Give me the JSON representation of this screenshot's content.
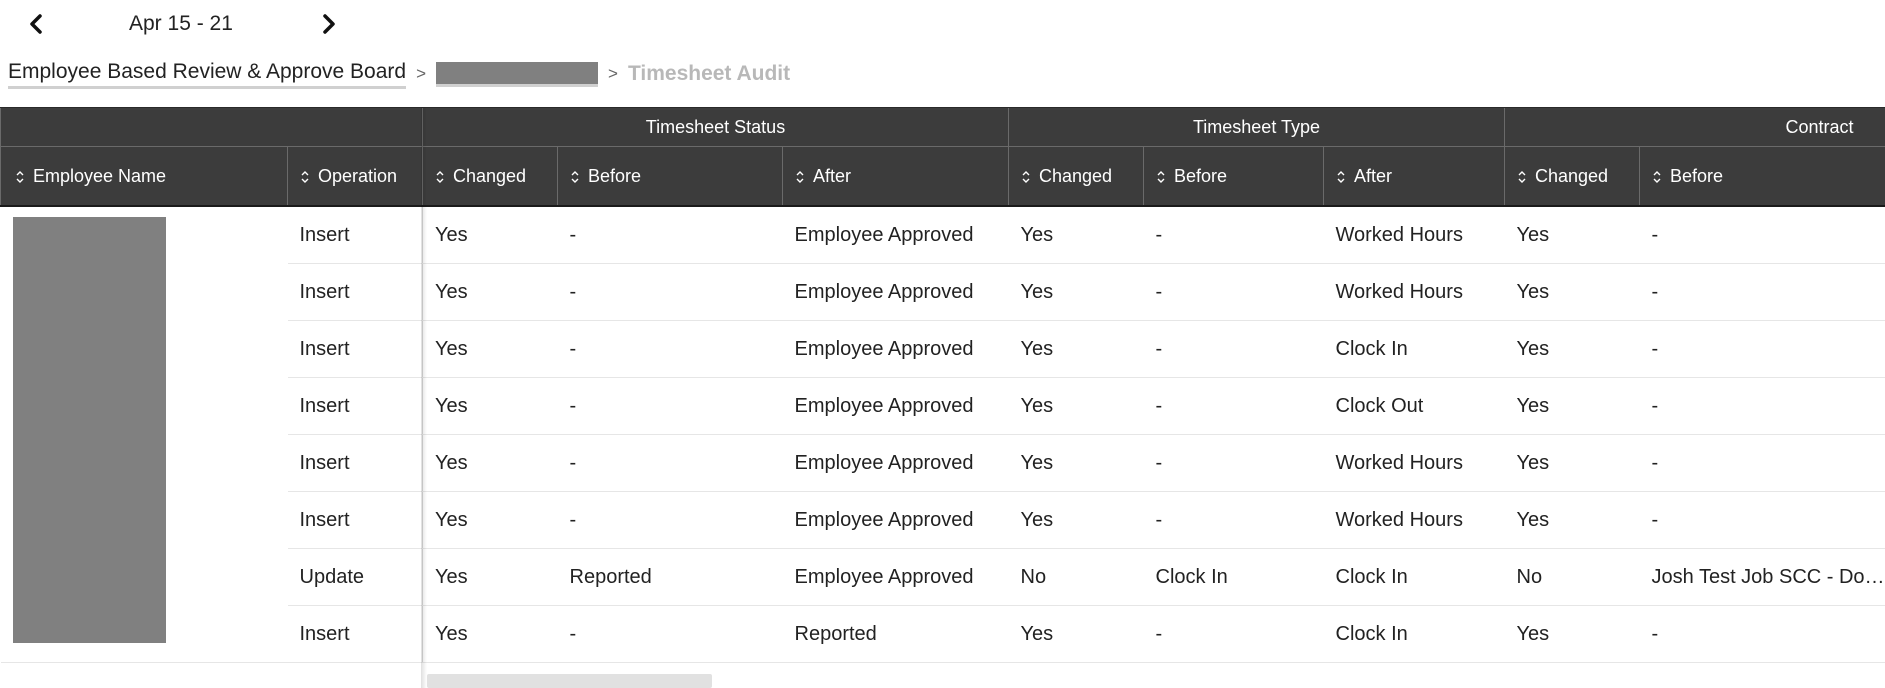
{
  "header": {
    "date_range": "Apr 15 - 21",
    "prev_icon": "chevron-left-icon",
    "next_icon": "chevron-right-icon"
  },
  "breadcrumb": {
    "board": "Employee Based Review & Approve Board",
    "sep1": ">",
    "sep2": ">",
    "current": "Timesheet Audit"
  },
  "table": {
    "groups": {
      "timesheet_status": "Timesheet Status",
      "timesheet_type": "Timesheet Type",
      "contract": "Contract"
    },
    "columns": {
      "employee_name": "Employee Name",
      "operation": "Operation",
      "ts_changed": "Changed",
      "ts_before": "Before",
      "ts_after": "After",
      "tt_changed": "Changed",
      "tt_before": "Before",
      "tt_after": "After",
      "c_changed": "Changed",
      "c_before": "Before"
    },
    "sort_icon": "sort-icon",
    "rows": [
      {
        "operation": "Insert",
        "ts_changed": "Yes",
        "ts_before": "-",
        "ts_after": "Employee Approved",
        "tt_changed": "Yes",
        "tt_before": "-",
        "tt_after": "Worked Hours",
        "c_changed": "Yes",
        "c_before": "-"
      },
      {
        "operation": "Insert",
        "ts_changed": "Yes",
        "ts_before": "-",
        "ts_after": "Employee Approved",
        "tt_changed": "Yes",
        "tt_before": "-",
        "tt_after": "Worked Hours",
        "c_changed": "Yes",
        "c_before": "-"
      },
      {
        "operation": "Insert",
        "ts_changed": "Yes",
        "ts_before": "-",
        "ts_after": "Employee Approved",
        "tt_changed": "Yes",
        "tt_before": "-",
        "tt_after": "Clock In",
        "c_changed": "Yes",
        "c_before": "-"
      },
      {
        "operation": "Insert",
        "ts_changed": "Yes",
        "ts_before": "-",
        "ts_after": "Employee Approved",
        "tt_changed": "Yes",
        "tt_before": "-",
        "tt_after": "Clock Out",
        "c_changed": "Yes",
        "c_before": "-"
      },
      {
        "operation": "Insert",
        "ts_changed": "Yes",
        "ts_before": "-",
        "ts_after": "Employee Approved",
        "tt_changed": "Yes",
        "tt_before": "-",
        "tt_after": "Worked Hours",
        "c_changed": "Yes",
        "c_before": "-"
      },
      {
        "operation": "Insert",
        "ts_changed": "Yes",
        "ts_before": "-",
        "ts_after": "Employee Approved",
        "tt_changed": "Yes",
        "tt_before": "-",
        "tt_after": "Worked Hours",
        "c_changed": "Yes",
        "c_before": "-"
      },
      {
        "operation": "Update",
        "ts_changed": "Yes",
        "ts_before": "Reported",
        "ts_after": "Employee Approved",
        "tt_changed": "No",
        "tt_before": "Clock In",
        "tt_after": "Clock In",
        "c_changed": "No",
        "c_before": "Josh Test Job SCC - Do ..."
      },
      {
        "operation": "Insert",
        "ts_changed": "Yes",
        "ts_before": "-",
        "ts_after": "Reported",
        "tt_changed": "Yes",
        "tt_before": "-",
        "tt_after": "Clock In",
        "c_changed": "Yes",
        "c_before": "-"
      }
    ]
  },
  "colors": {
    "header_bg": "#3c3c3c",
    "redaction": "#808080",
    "breadcrumb_current": "#b8b8b8"
  }
}
